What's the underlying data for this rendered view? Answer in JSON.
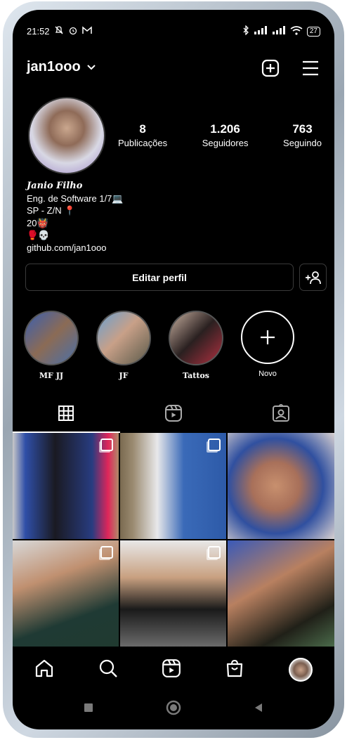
{
  "status_bar": {
    "time": "21:52",
    "battery": "27"
  },
  "header": {
    "username": "jan1ooo"
  },
  "stats": [
    {
      "value": "8",
      "label": "Publicações"
    },
    {
      "value": "1.206",
      "label": "Seguidores"
    },
    {
      "value": "763",
      "label": "Seguindo"
    }
  ],
  "bio": {
    "name": "Janio Filho",
    "lines": [
      "Eng. de Software 1/7💻",
      "SP - Z/N 📍",
      "20👹",
      "🥊💀"
    ],
    "link": "github.com/jan1ooo"
  },
  "actions": {
    "edit_profile": "Editar perfil"
  },
  "highlights": [
    {
      "label": "MF JJ"
    },
    {
      "label": "JF"
    },
    {
      "label": "Tattos"
    },
    {
      "label": "Novo"
    }
  ],
  "colors": {
    "background": "#000000",
    "text": "#ffffff",
    "border": "#3a3a3a"
  }
}
